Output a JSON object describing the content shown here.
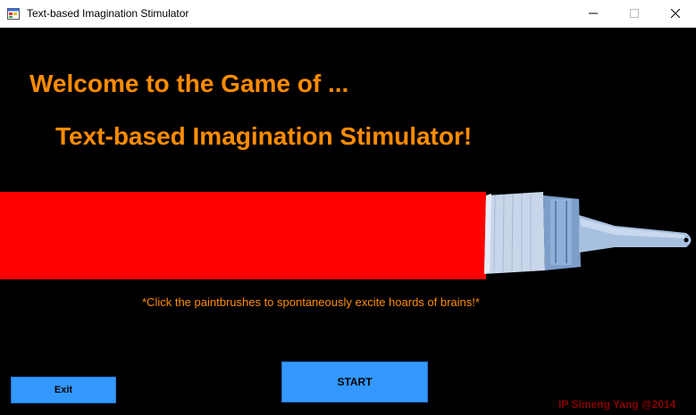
{
  "window": {
    "title": "Text-based Imagination Stimulator",
    "controls": [
      "minimize-icon",
      "maximize-icon",
      "close-icon"
    ]
  },
  "main": {
    "welcome": "Welcome to the Game of ...",
    "subtitle": "Text-based Imagination Stimulator!",
    "hint": "*Click the paintbrushes to spontaneously excite hoards of brains!*",
    "credit": "IP Simeng Yang @2014"
  },
  "buttons": {
    "exit_label": "Exit",
    "start_label": "START"
  },
  "colors": {
    "background": "#000000",
    "heading": "#ff8c00",
    "paint": "#ff0000",
    "button": "#3399ff",
    "credit": "#8b0000"
  }
}
